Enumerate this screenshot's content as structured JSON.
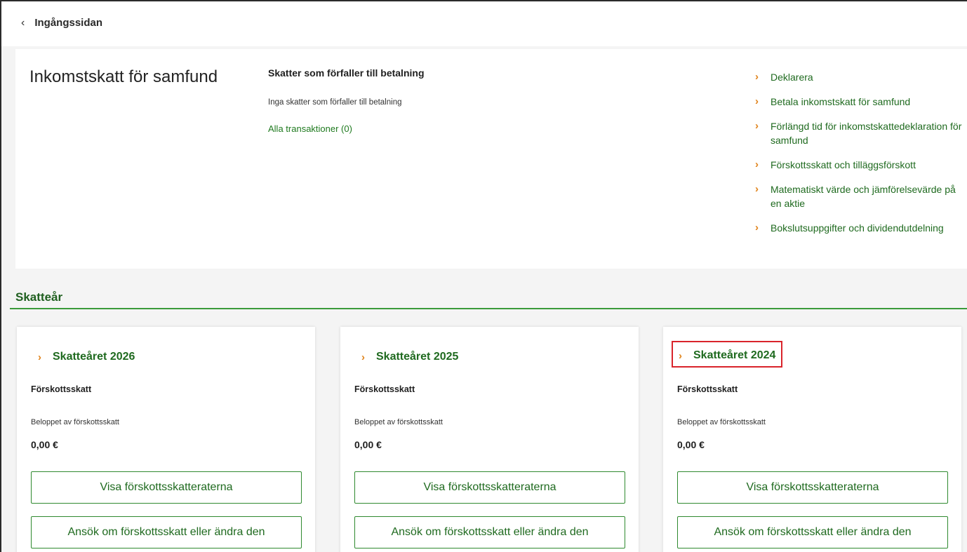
{
  "nav": {
    "back_label": "Ingångssidan"
  },
  "summary": {
    "title": "Inkomstskatt för samfund",
    "due_heading": "Skatter som förfaller till betalning",
    "due_none": "Inga skatter som förfaller till betalning",
    "transactions_link": "Alla transaktioner (0)",
    "links": [
      "Deklarera",
      "Betala inkomstskatt för samfund",
      "Förlängd tid för inkomstskattedeklaration för samfund",
      "Förskottsskatt och tilläggsförskott",
      "Matematiskt värde och jämförelsevärde på en aktie",
      "Bokslutsuppgifter och dividendutdelning"
    ]
  },
  "section": {
    "title": "Skatteår"
  },
  "cards": [
    {
      "year_label": "Skatteåret 2026",
      "field_title": "Förskottsskatt",
      "amount_label": "Beloppet av förskottsskatt",
      "amount": "0,00 €",
      "view_button": "Visa förskottsskatteraterna",
      "apply_button": "Ansök om förskottsskatt eller ändra den"
    },
    {
      "year_label": "Skatteåret 2025",
      "field_title": "Förskottsskatt",
      "amount_label": "Beloppet av förskottsskatt",
      "amount": "0,00 €",
      "view_button": "Visa förskottsskatteraterna",
      "apply_button": "Ansök om förskottsskatt eller ändra den"
    },
    {
      "year_label": "Skatteåret 2024",
      "field_title": "Förskottsskatt",
      "amount_label": "Beloppet av förskottsskatt",
      "amount": "0,00 €",
      "view_button": "Visa förskottsskatteraterna",
      "apply_button": "Ansök om förskottsskatt eller ändra den"
    }
  ],
  "icons": {
    "back": "chevron-left-icon",
    "link_arrow": "chevron-right-icon"
  },
  "colors": {
    "accent_green": "#1f6a1f",
    "arrow_orange": "#e0831a",
    "highlight_red": "#d9242b"
  }
}
